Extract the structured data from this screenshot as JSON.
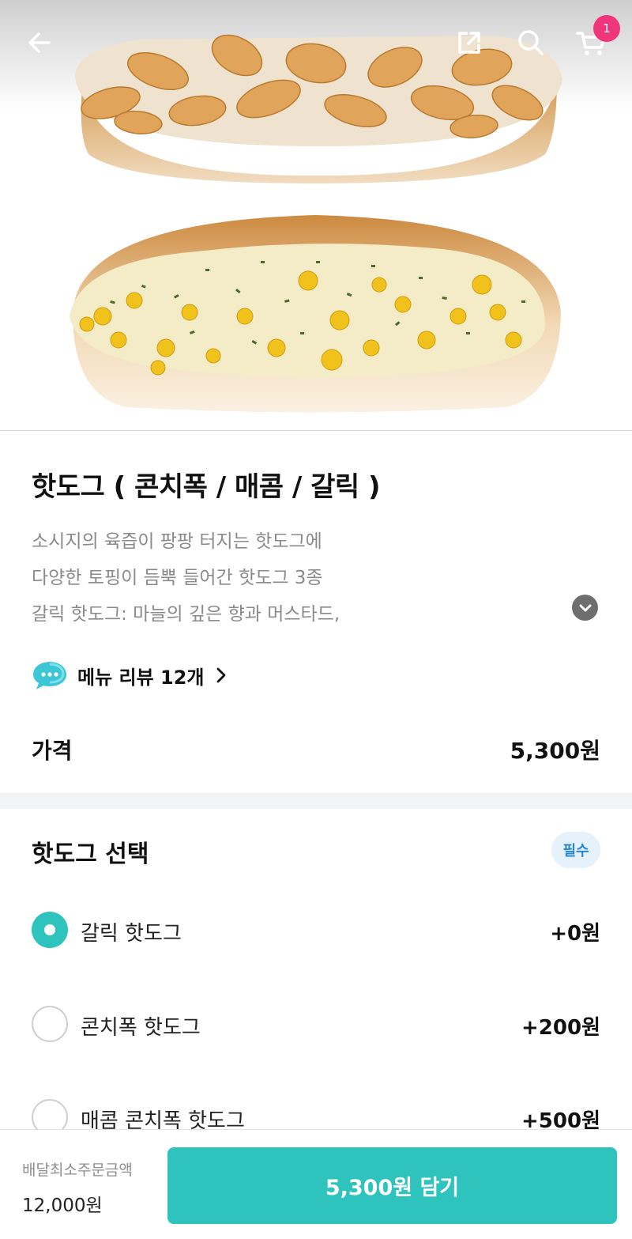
{
  "header": {
    "back_icon": "arrow-left-icon",
    "share_icon": "share-icon",
    "search_icon": "search-icon",
    "cart_icon": "cart-icon",
    "cart_badge": "1"
  },
  "hero": {
    "image_icon": "hotdog-photo"
  },
  "product": {
    "title": "핫도그 ( 콘치폭 / 매콤 / 갈릭 )",
    "description_lines": [
      "소시지의 육즙이 팡팡 터지는 핫도그에",
      "다양한 토핑이 듬뿍 들어간 핫도그 3종",
      "갈릭 핫도그: 마늘의 깊은 향과 머스타드,"
    ],
    "review_label": "메뉴 리뷰 12개",
    "price_label": "가격",
    "price_value": "5,300원"
  },
  "option_group": {
    "title": "핫도그 선택",
    "required_label": "필수",
    "options": [
      {
        "name": "갈릭 핫도그",
        "price": "+0원",
        "selected": true
      },
      {
        "name": "콘치폭 핫도그",
        "price": "+200원",
        "selected": false
      },
      {
        "name": "매콤 콘치폭 핫도그",
        "price": "+500원",
        "selected": false
      }
    ]
  },
  "bottom_bar": {
    "min_order_label": "배달최소주문금액",
    "min_order_value": "12,000원",
    "add_button_label": "5,300원 담기"
  },
  "colors": {
    "accent": "#2ec4bd",
    "badge": "#f0357a",
    "required_bg": "#e5f2fb",
    "required_text": "#2a86d6"
  }
}
